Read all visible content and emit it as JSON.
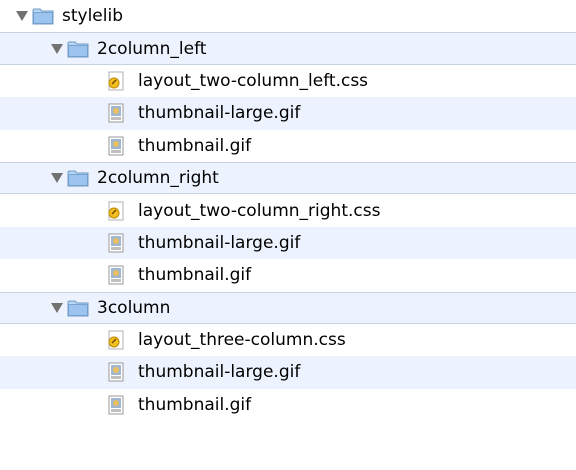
{
  "tree": {
    "root": {
      "name": "stylelib",
      "icon": "folder-icon",
      "expanded": true
    },
    "folders": [
      {
        "name": "2column_left",
        "icon": "folder-icon",
        "expanded": true,
        "files": [
          {
            "name": "layout_two-column_left.css",
            "icon": "css-file-icon"
          },
          {
            "name": "thumbnail-large.gif",
            "icon": "gif-file-icon"
          },
          {
            "name": "thumbnail.gif",
            "icon": "gif-file-icon"
          }
        ]
      },
      {
        "name": "2column_right",
        "icon": "folder-icon",
        "expanded": true,
        "files": [
          {
            "name": "layout_two-column_right.css",
            "icon": "css-file-icon"
          },
          {
            "name": "thumbnail-large.gif",
            "icon": "gif-file-icon"
          },
          {
            "name": "thumbnail.gif",
            "icon": "gif-file-icon"
          }
        ]
      },
      {
        "name": "3column",
        "icon": "folder-icon",
        "expanded": true,
        "files": [
          {
            "name": "layout_three-column.css",
            "icon": "css-file-icon"
          },
          {
            "name": "thumbnail-large.gif",
            "icon": "gif-file-icon"
          },
          {
            "name": "thumbnail.gif",
            "icon": "gif-file-icon"
          }
        ]
      }
    ]
  },
  "colors": {
    "alt_row": "#edf3fe",
    "separator": "#c6d2e2",
    "disclosure": "#727272",
    "folder": "#9cc4ee"
  }
}
